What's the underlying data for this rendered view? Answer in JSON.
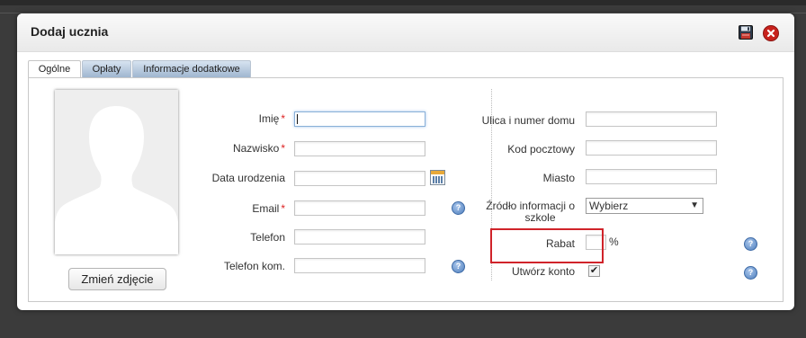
{
  "dialog": {
    "title": "Dodaj ucznia"
  },
  "tabs": [
    {
      "label": "Ogólne",
      "active": true
    },
    {
      "label": "Opłaty",
      "active": false
    },
    {
      "label": "Informacje dodatkowe",
      "active": false
    }
  ],
  "photo": {
    "change_label": "Zmień zdjęcie"
  },
  "fields_left": {
    "first_name": {
      "label": "Imię",
      "required": "*",
      "value": ""
    },
    "last_name": {
      "label": "Nazwisko",
      "required": "*",
      "value": ""
    },
    "birth_date": {
      "label": "Data urodzenia",
      "value": ""
    },
    "email": {
      "label": "Email",
      "required": "*",
      "value": ""
    },
    "phone": {
      "label": "Telefon",
      "value": ""
    },
    "mobile": {
      "label": "Telefon kom.",
      "value": ""
    }
  },
  "fields_right": {
    "street": {
      "label": "Ulica i numer domu",
      "value": ""
    },
    "postal": {
      "label": "Kod pocztowy",
      "value": ""
    },
    "city": {
      "label": "Miasto",
      "value": ""
    },
    "source": {
      "label_line1": "Źródło informacji o",
      "label_line2": "szkole",
      "selected": "Wybierz"
    },
    "discount": {
      "label": "Rabat",
      "value": "",
      "unit": "%"
    },
    "create_account": {
      "label": "Utwórz konto",
      "checked": true
    }
  },
  "icons": {
    "save": "floppy-disk-icon",
    "close": "close-icon",
    "calendar": "calendar-icon",
    "help": "help-icon"
  },
  "colors": {
    "accent_required": "#dd2222",
    "highlight_box": "#d0232a",
    "close_button": "#c8221d"
  }
}
